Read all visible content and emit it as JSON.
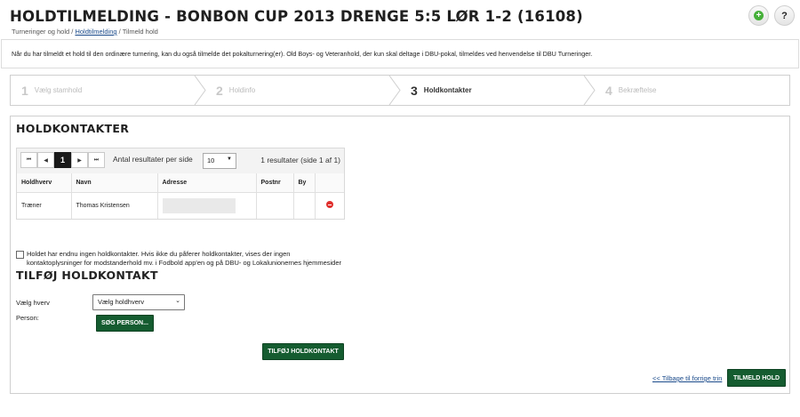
{
  "header": {
    "title": "HOLDTILMELDING - BONBON CUP 2013 DRENGE 5:5 LØR 1-2 (16108)",
    "breadcrumb": {
      "item1": "Turneringer og hold",
      "sep": " / ",
      "item2": "Holdtilmelding",
      "item3": "Tilmeld hold"
    },
    "add_button_symbol": "+",
    "help_button_symbol": "?"
  },
  "info": {
    "text": "Når du har tilmeldt et hold til den ordinære turnering, kan du også tilmelde det pokalturnering(er). Old Boys- og Veteranhold, der kun skal deltage i DBU-pokal, tilmeldes ved henvendelse til DBU Turneringer."
  },
  "steps": [
    {
      "num": "1",
      "label": "Vælg stamhold",
      "active": false
    },
    {
      "num": "2",
      "label": "Holdinfo",
      "active": false
    },
    {
      "num": "3",
      "label": "Holdkontakter",
      "active": true
    },
    {
      "num": "4",
      "label": "Bekræftelse",
      "active": false
    }
  ],
  "contacts": {
    "title": "HOLDKONTAKTER",
    "pager": {
      "first": "⏮",
      "prev": "◀",
      "current": "1",
      "next": "▶",
      "last": "⏭",
      "per_page_label": "Antal resultater per side",
      "per_page_value": "10",
      "result_text": "1 resultater (side 1 af 1)"
    },
    "columns": [
      "Holdhverv",
      "Navn",
      "Adresse",
      "Postnr",
      "By"
    ],
    "rows": [
      {
        "holdhverv": "Træner",
        "navn": "Thomas Kristensen",
        "adresse": "",
        "postnr": "",
        "by": ""
      }
    ]
  },
  "no_contact": {
    "text": "Holdet har endnu ingen holdkontakter. Hvis ikke du påferer holdkontakter, vises der ingen kontaktoplysninger for modstanderhold mv. i Fodbold app'en og på DBU- og Lokalunionernes hjemmesider",
    "checked": false
  },
  "add_contact": {
    "title": "TILFØJ HOLDKONTAKT",
    "hverv_label": "Vælg hverv",
    "hverv_select_value": "Vælg holdhverv",
    "person_label": "Person:",
    "search_button": "SØG PERSON...",
    "add_button": "TILFØJ HOLDKONTAKT"
  },
  "footer": {
    "back_link": "<< Tilbage til forrige trin",
    "submit_button": "TILMELD HOLD"
  },
  "colors": {
    "primary_green": "#155c30",
    "add_icon_green": "#46b03a",
    "remove_red": "#e0302e",
    "link_blue": "#1a4a8a"
  }
}
